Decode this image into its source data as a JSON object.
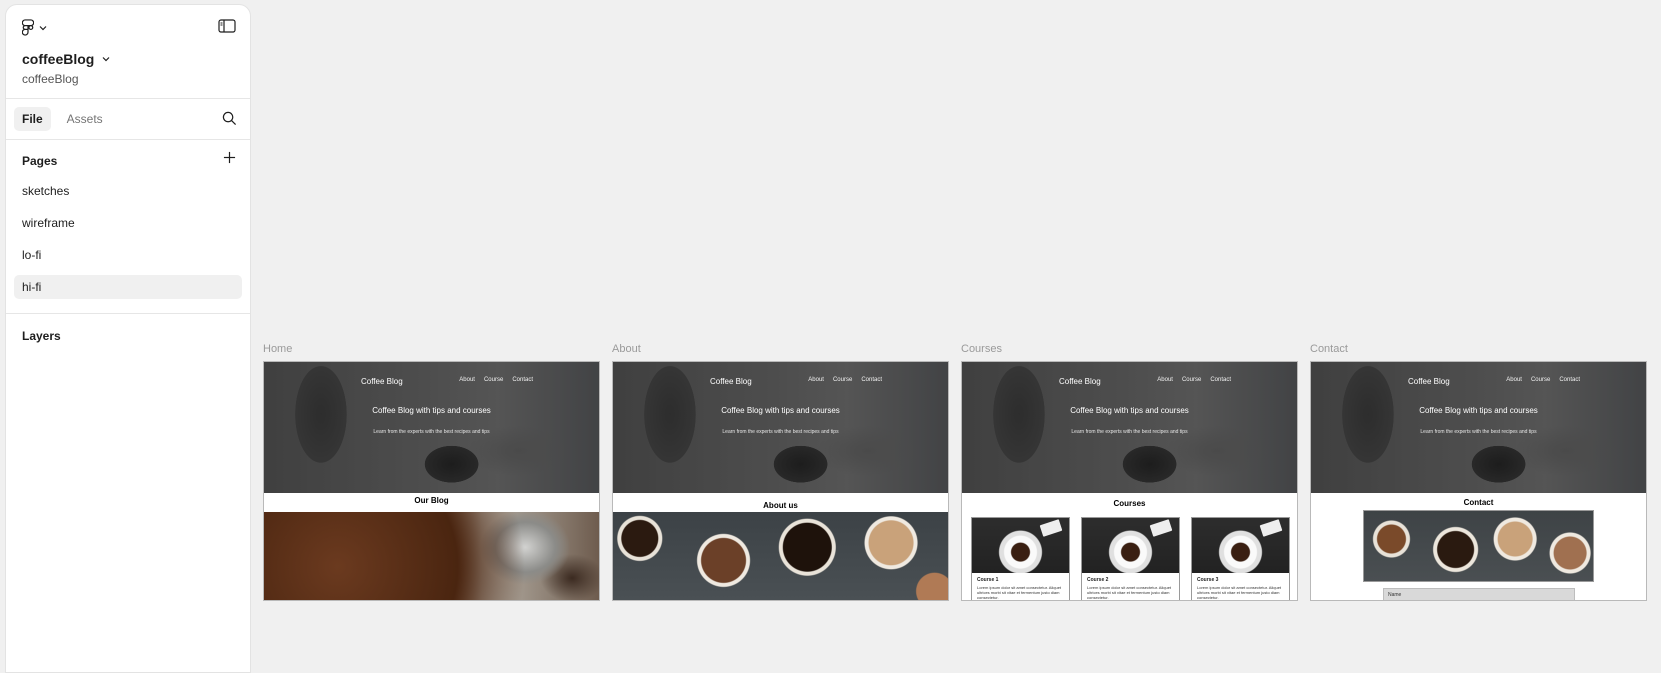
{
  "file": {
    "title": "coffeeBlog",
    "subtitle": "coffeeBlog"
  },
  "tabs": [
    {
      "label": "File",
      "active": true
    },
    {
      "label": "Assets",
      "active": false
    }
  ],
  "pages": {
    "heading": "Pages",
    "items": [
      {
        "label": "sketches"
      },
      {
        "label": "wireframe"
      },
      {
        "label": "lo-fi"
      },
      {
        "label": "hi-fi",
        "selected": true
      }
    ]
  },
  "layers": {
    "heading": "Layers"
  },
  "icons": {
    "logo": "figma-logo-icon",
    "panel_toggle": "sidebar-toggle-icon",
    "search": "search-icon",
    "add": "plus-icon"
  },
  "frames": [
    {
      "label": "Home",
      "hero": {
        "brand": "Coffee Blog",
        "nav": [
          "About",
          "Course",
          "Contact"
        ],
        "title": "Coffee Blog with tips and courses",
        "subtitle": "Learn from the experts with the best recipes and tips"
      },
      "section": "Our Blog"
    },
    {
      "label": "About",
      "hero": {
        "brand": "Coffee Blog",
        "nav": [
          "About",
          "Course",
          "Contact"
        ],
        "title": "Coffee Blog with tips and courses",
        "subtitle": "Learn from the experts with the best recipes and tips"
      },
      "section": "About us"
    },
    {
      "label": "Courses",
      "hero": {
        "brand": "Coffee Blog",
        "nav": [
          "About",
          "Course",
          "Contact"
        ],
        "title": "Coffee Blog with tips and courses",
        "subtitle": "Learn from the experts with the best recipes and tips"
      },
      "section": "Courses",
      "courses": [
        {
          "title": "Course 1",
          "text": "Lorem ipsum dolor sit amet consectetur. Aliquet ultrices morbi sit vitae et fermentum justo diam consectetur."
        },
        {
          "title": "Course 2",
          "text": "Lorem ipsum dolor sit amet consectetur. Aliquet ultrices morbi sit vitae et fermentum justo diam consectetur."
        },
        {
          "title": "Course 3",
          "text": "Lorem ipsum dolor sit amet consectetur. Aliquet ultrices morbi sit vitae et fermentum justo diam consectetur."
        }
      ]
    },
    {
      "label": "Contact",
      "hero": {
        "brand": "Coffee Blog",
        "nav": [
          "About",
          "Course",
          "Contact"
        ],
        "title": "Coffee Blog with tips and courses",
        "subtitle": "Learn from the experts with the best recipes and tips"
      },
      "section": "Contact",
      "field_label": "Name"
    }
  ]
}
